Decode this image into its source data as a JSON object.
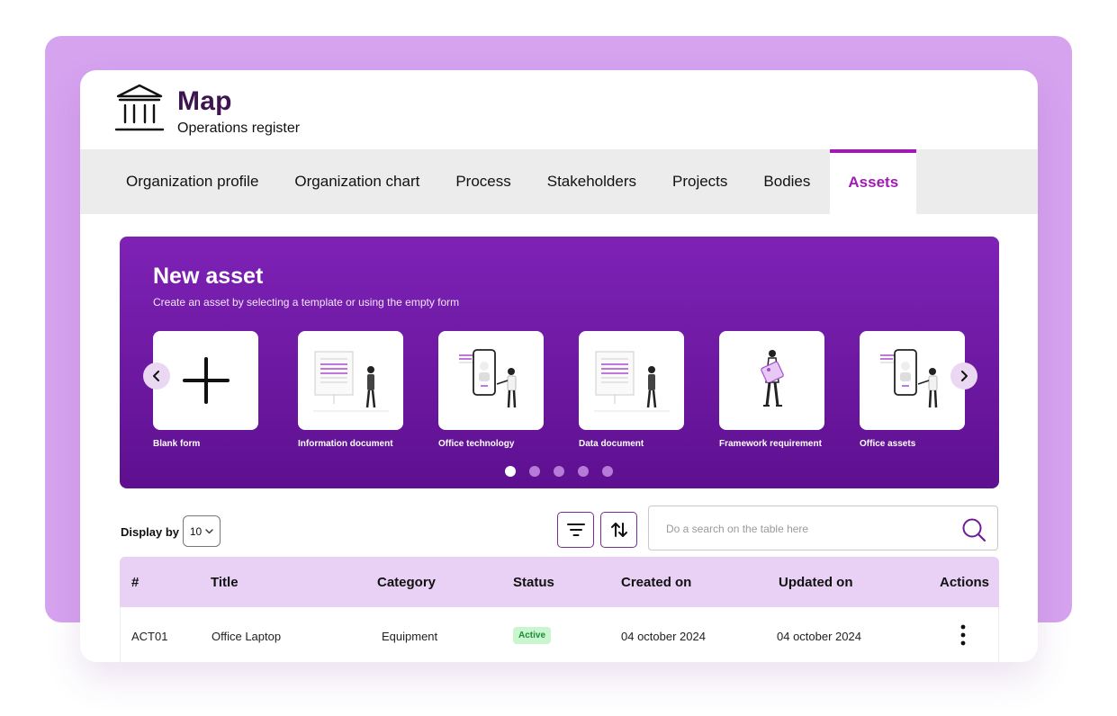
{
  "header": {
    "title": "Map",
    "subtitle": "Operations register",
    "logo_icon": "institution-icon"
  },
  "tabs": [
    {
      "label": "Organization profile",
      "active": false
    },
    {
      "label": "Organization chart",
      "active": false
    },
    {
      "label": "Process",
      "active": false
    },
    {
      "label": "Stakeholders",
      "active": false
    },
    {
      "label": "Projects",
      "active": false
    },
    {
      "label": "Bodies",
      "active": false
    },
    {
      "label": "Assets",
      "active": true
    }
  ],
  "banner": {
    "title": "New asset",
    "subtitle": "Create an asset by selecting a template or using the empty form",
    "templates": [
      {
        "label": "Blank form",
        "icon": "plus-icon"
      },
      {
        "label": "Information document",
        "icon": "document-illustration-icon"
      },
      {
        "label": "Office technology",
        "icon": "phone-illustration-icon"
      },
      {
        "label": "Data document",
        "icon": "document-illustration-icon"
      },
      {
        "label": "Framework requirement",
        "icon": "person-illustration-icon"
      },
      {
        "label": "Office assets",
        "icon": "phone-illustration-icon"
      }
    ],
    "prev_icon": "chevron-left-icon",
    "next_icon": "chevron-right-icon",
    "pagination": {
      "pages": 5,
      "current": 1
    }
  },
  "controls": {
    "display_label": "Display by",
    "display_value": "10",
    "filter_icon": "filter-icon",
    "sort_icon": "sort-icon",
    "search_placeholder": "Do a search on the table here",
    "search_icon": "search-icon"
  },
  "table": {
    "columns": [
      "#",
      "Title",
      "Category",
      "Status",
      "Created on",
      "Updated on",
      "Actions"
    ],
    "rows": [
      {
        "id": "ACT01",
        "title": "Office Laptop",
        "category": "Equipment",
        "status": "Active",
        "created": "04 october 2024",
        "updated": "04 october 2024"
      }
    ]
  },
  "colors": {
    "accent": "#a11ab4",
    "banner_top": "#7e22b6",
    "banner_bottom": "#5e1090",
    "header_row": "#e8d1f5",
    "status_bg": "#c9f5cf",
    "status_text": "#1f8a3a",
    "outer_panel": "#d6a3ef"
  }
}
